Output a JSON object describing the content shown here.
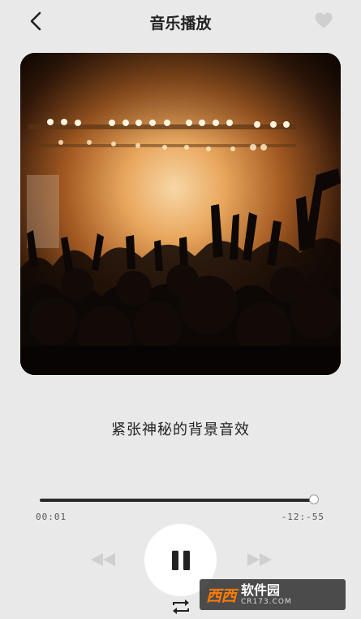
{
  "header": {
    "title": "音乐播放",
    "back_icon": "chevron-left-icon",
    "favorite_icon": "heart-icon",
    "favorite_color": "#cfcfcf"
  },
  "cover": {
    "description_icon": "concert-crowd-image"
  },
  "track": {
    "title": "紧张神秘的背景音效",
    "elapsed": "00:01",
    "remaining": "-12:-55",
    "progress_fraction": 0.995
  },
  "controls": {
    "prev_icon": "rewind-icon",
    "play_pause_icon": "pause-icon",
    "next_icon": "fast-forward-icon",
    "loop_icon": "repeat-icon",
    "inactive_color": "#cfcfcf",
    "active_color": "#222222"
  },
  "watermark": {
    "brand": "西西",
    "name": "软件园",
    "url": "CR173.COM"
  }
}
